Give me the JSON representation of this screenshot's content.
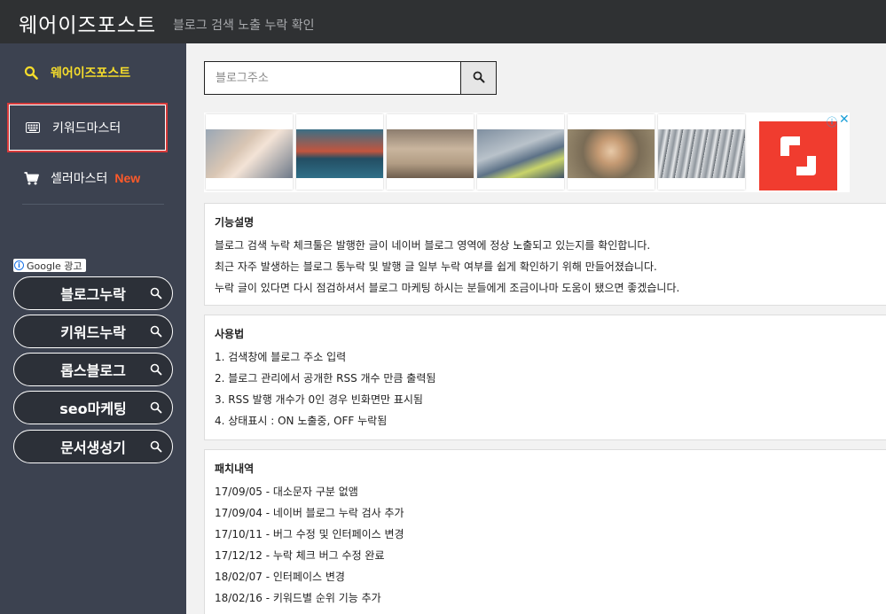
{
  "header": {
    "brand": "웨어이즈포스트",
    "subtitle": "블로그 검색 노출 누락 확인"
  },
  "sidebar": {
    "items": [
      {
        "label": "웨어이즈포스트",
        "icon": "search-icon"
      },
      {
        "label": "키워드마스터",
        "icon": "keyboard-icon"
      },
      {
        "label": "셀러마스터",
        "icon": "cart-icon",
        "badge": "New"
      }
    ],
    "ad_label": "Google 광고",
    "pills": [
      "블로그누락",
      "키워드누락",
      "롭스블로그",
      "seo마케팅",
      "문서생성기"
    ]
  },
  "search": {
    "placeholder": "블로그주소"
  },
  "sections": {
    "features": {
      "title": "기능설명",
      "lines": [
        "블로그 검색 누락 체크툴은 발행한 글이 네이버 블로그 영역에 정상 노출되고 있는지를 확인합니다.",
        "최근 자주 발생하는 블로그 통누락 및 발행 글 일부 누락 여부를 쉽게 확인하기 위해 만들어졌습니다.",
        "누락 글이 있다면 다시 점검하셔서 블로그 마케팅 하시는 분들에게 조금이나마 도움이 됐으면 좋겠습니다."
      ]
    },
    "usage": {
      "title": "사용법",
      "lines": [
        "1. 검색창에 블로그 주소 입력",
        "2. 블로그 관리에서 공개한 RSS 개수 만큼 출력됨",
        "3. RSS 발행 개수가 0인 경우 빈화면만 표시됨",
        "4. 상태표시 : ON 노출중, OFF 누락됨"
      ]
    },
    "patch": {
      "title": "패치내역",
      "lines": [
        "17/09/05 - 대소문자 구분 없앰",
        "17/09/04 - 네이버 블로그 누락 검사 추가",
        "17/10/11 - 버그 수정 및 인터페이스 변경",
        "17/12/12 - 누락 체크 버그 수정 완료",
        "18/02/07 - 인터페이스 변경",
        "18/02/16 - 키워드별 순위 기능 추가"
      ]
    }
  },
  "colors": {
    "header_bg": "#2f3133",
    "sidebar_bg": "#3c4250",
    "accent_yellow": "#f5dc2b",
    "new_badge": "#ff5a2a",
    "ad_logo": "#f03c2f"
  }
}
